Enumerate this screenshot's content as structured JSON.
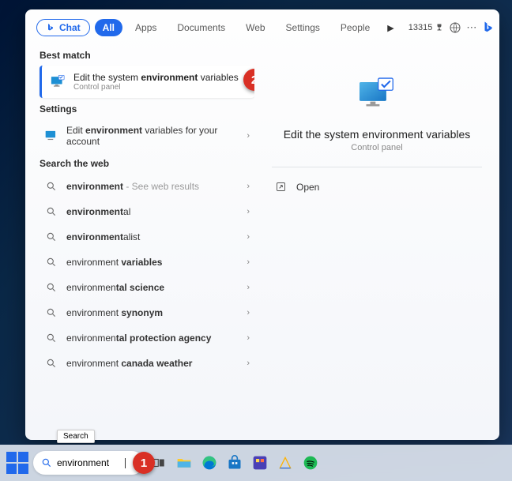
{
  "tabs": {
    "chat": "Chat",
    "all": "All",
    "apps": "Apps",
    "documents": "Documents",
    "web": "Web",
    "settings": "Settings",
    "people": "People"
  },
  "points": "13315",
  "sections": {
    "best": "Best match",
    "settings": "Settings",
    "web": "Search the web"
  },
  "bestMatch": {
    "title_pre": "Edit the system ",
    "title_bold": "environment",
    "title_post": " variables",
    "sub": "Control panel"
  },
  "settingsResult": {
    "pre": "Edit ",
    "bold": "environment",
    "post": " variables for your account"
  },
  "webResults": [
    {
      "pre": "",
      "bold": "environment",
      "post": "",
      "suffix": " - See web results"
    },
    {
      "pre": "",
      "bold": "environment",
      "post": "al",
      "suffix": ""
    },
    {
      "pre": "",
      "bold": "environment",
      "post": "alist",
      "suffix": ""
    },
    {
      "pre": "environment ",
      "bold": "variables",
      "post": "",
      "suffix": ""
    },
    {
      "pre": "environmen",
      "bold": "tal science",
      "post": "",
      "suffix": ""
    },
    {
      "pre": "environment ",
      "bold": "synonym",
      "post": "",
      "suffix": ""
    },
    {
      "pre": "environmen",
      "bold": "tal protection agency",
      "post": "",
      "suffix": ""
    },
    {
      "pre": "environment ",
      "bold": "canada weather",
      "post": "",
      "suffix": ""
    }
  ],
  "details": {
    "title": "Edit the system environment variables",
    "sub": "Control panel",
    "open": "Open"
  },
  "searchInput": "environment",
  "tooltip": "Search",
  "badges": {
    "one": "1",
    "two": "2"
  }
}
